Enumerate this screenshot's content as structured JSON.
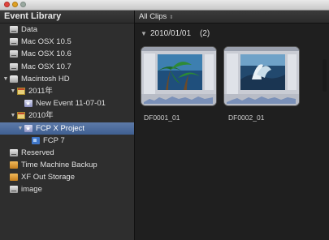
{
  "window": {
    "controls": [
      "close",
      "minimize",
      "zoom"
    ]
  },
  "sidebar": {
    "title": "Event Library",
    "items": [
      {
        "label": "Data",
        "icon": "drive-icon",
        "level": 0,
        "disclosure": ""
      },
      {
        "label": "Mac OSX 10.5",
        "icon": "drive-icon",
        "level": 0,
        "disclosure": ""
      },
      {
        "label": "Mac OSX 10.6",
        "icon": "drive-icon",
        "level": 0,
        "disclosure": ""
      },
      {
        "label": "Mac OSX 10.7",
        "icon": "drive-icon",
        "level": 0,
        "disclosure": ""
      },
      {
        "label": "Macintosh HD",
        "icon": "hard-disk-icon",
        "level": 0,
        "disclosure": "▼"
      },
      {
        "label": "2011年",
        "icon": "calendar-icon",
        "level": 1,
        "disclosure": "▼"
      },
      {
        "label": "New Event 11-07-01",
        "icon": "event-icon",
        "level": 2,
        "disclosure": ""
      },
      {
        "label": "2010年",
        "icon": "calendar-icon",
        "level": 1,
        "disclosure": "▼"
      },
      {
        "label": "FCP X Project",
        "icon": "event-icon",
        "level": 2,
        "disclosure": "▼",
        "selected": true
      },
      {
        "label": "FCP 7",
        "icon": "project-icon",
        "level": 3,
        "disclosure": ""
      },
      {
        "label": "Reserved",
        "icon": "drive-icon",
        "level": 0,
        "disclosure": ""
      },
      {
        "label": "Time Machine Backup",
        "icon": "orange-drive-icon",
        "level": 0,
        "disclosure": ""
      },
      {
        "label": "XF Out Storage",
        "icon": "orange-drive-icon",
        "level": 0,
        "disclosure": ""
      },
      {
        "label": "image",
        "icon": "drive-icon",
        "level": 0,
        "disclosure": ""
      }
    ]
  },
  "browser": {
    "filter_label": "All Clips",
    "filter_arrows": "⇕",
    "group": {
      "label": "2010/01/01",
      "count": "(2)"
    },
    "clips": [
      {
        "name": "DF0001_01",
        "thumbnail": "palm-trees-scene"
      },
      {
        "name": "DF0002_01",
        "thumbnail": "ocean-wave-scene"
      }
    ]
  },
  "colors": {
    "selection": "#4a6a9c",
    "sidebar_bg": "#2e2e2e",
    "browser_bg": "#1f1f1f"
  }
}
